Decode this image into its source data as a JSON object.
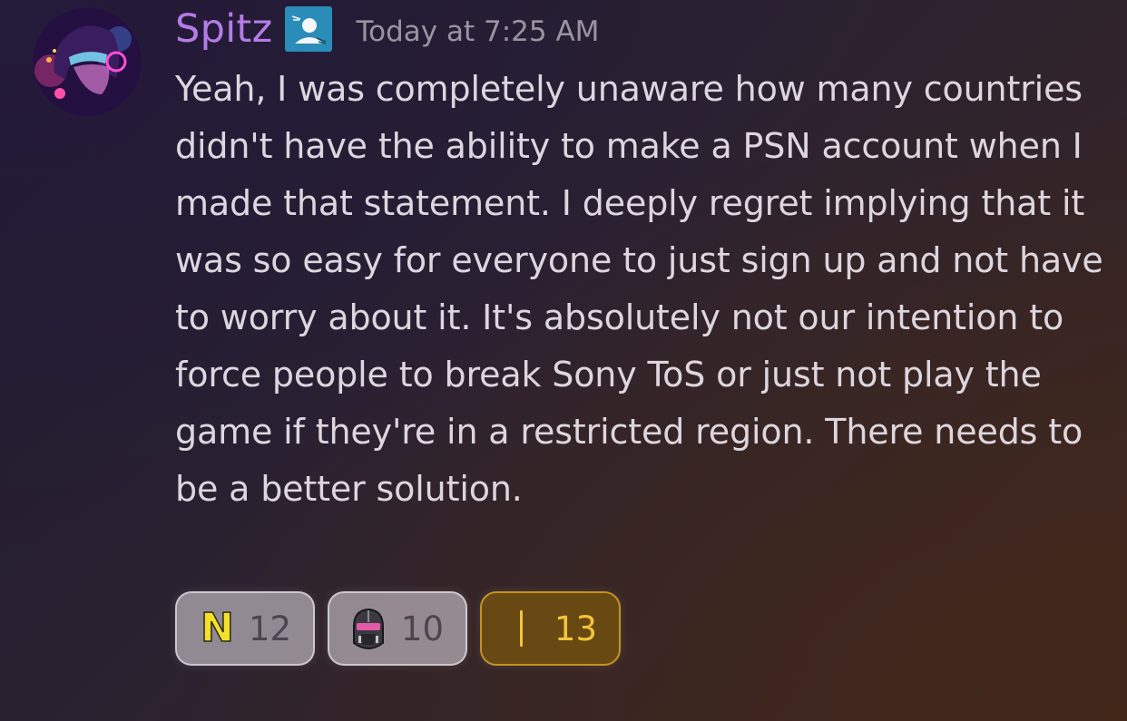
{
  "message": {
    "username": "Spitz",
    "timestamp": "Today at 7:25 AM",
    "text": "Yeah, I was completely unaware how many countries didn't have the ability to make a PSN account when I made that statement. I deeply regret implying that it was so easy for everyone to just sign up and not have to worry about it. It's absolutely not our intention to force people to break Sony ToS or just not play the game if they're in a restricted region. There needs to be a better solution.",
    "avatar_icon": "avatar-image",
    "role_badge_icon": "role-badge-icon"
  },
  "reactions": [
    {
      "emoji": "N",
      "emoji_name": "n-emoji",
      "count": "12",
      "active": false
    },
    {
      "emoji_name": "helmet-emoji",
      "count": "10",
      "active": false
    },
    {
      "emoji_name": "bar-emoji",
      "count": "13",
      "active": true
    }
  ],
  "colors": {
    "username": "#b47ce6",
    "role_badge": "#2a8cb8",
    "active_reaction_border": "#c49422",
    "active_reaction_count": "#f5c33b"
  }
}
